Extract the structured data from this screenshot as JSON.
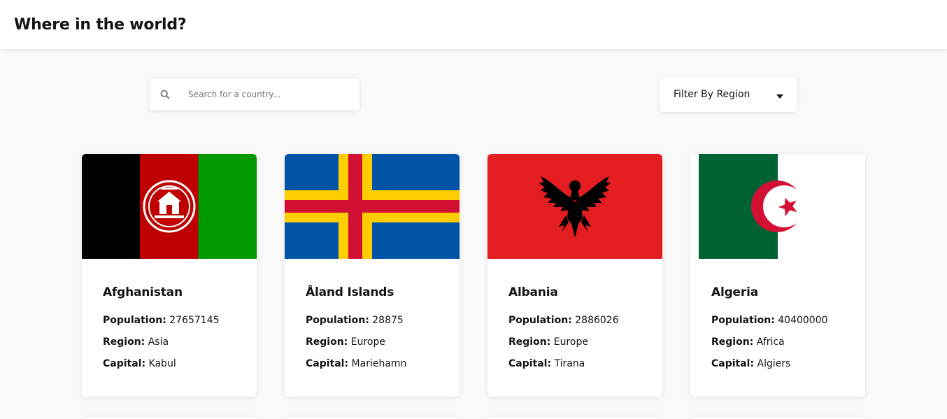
{
  "header": {
    "title": "Where in the world?"
  },
  "search": {
    "placeholder": "Search for a country..."
  },
  "filter": {
    "label": "Filter By Region"
  },
  "labels": {
    "population": "Population:",
    "region": "Region:",
    "capital": "Capital:"
  },
  "countries": [
    {
      "name": "Afghanistan",
      "population": "27657145",
      "region": "Asia",
      "capital": "Kabul",
      "flag_icon": "afghanistan-flag"
    },
    {
      "name": "Åland Islands",
      "population": "28875",
      "region": "Europe",
      "capital": "Mariehamn",
      "flag_icon": "aland-islands-flag"
    },
    {
      "name": "Albania",
      "population": "2886026",
      "region": "Europe",
      "capital": "Tirana",
      "flag_icon": "albania-flag"
    },
    {
      "name": "Algeria",
      "population": "40400000",
      "region": "Africa",
      "capital": "Algiers",
      "flag_icon": "algeria-flag"
    }
  ],
  "colors": {
    "background": "#fafafa",
    "surface": "#ffffff",
    "text": "#111517"
  }
}
